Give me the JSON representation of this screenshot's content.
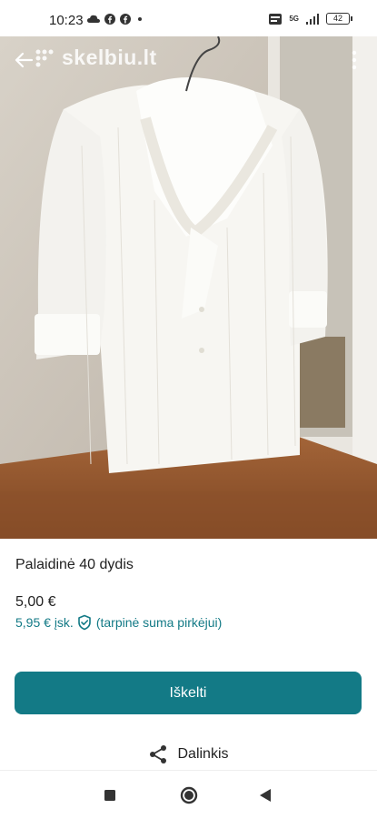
{
  "status": {
    "time": "10:23",
    "network": "5G",
    "battery": "42"
  },
  "header": {
    "logo_text": "skelbiu.lt"
  },
  "listing": {
    "title": "Palaidinė 40 dydis",
    "price": "5,00 €",
    "fee_price": "5,95 € įsk.",
    "fee_note": "(tarpinė suma pirkėjui)"
  },
  "actions": {
    "bump_label": "Iškelti",
    "share_label": "Dalinkis"
  },
  "colors": {
    "accent": "#137a86"
  },
  "icons": {
    "back": "arrow-left-icon",
    "more": "more-vertical-icon",
    "share": "share-icon",
    "shield": "shield-check-icon",
    "nav": [
      "square-icon",
      "circle-icon",
      "triangle-back-icon"
    ]
  }
}
